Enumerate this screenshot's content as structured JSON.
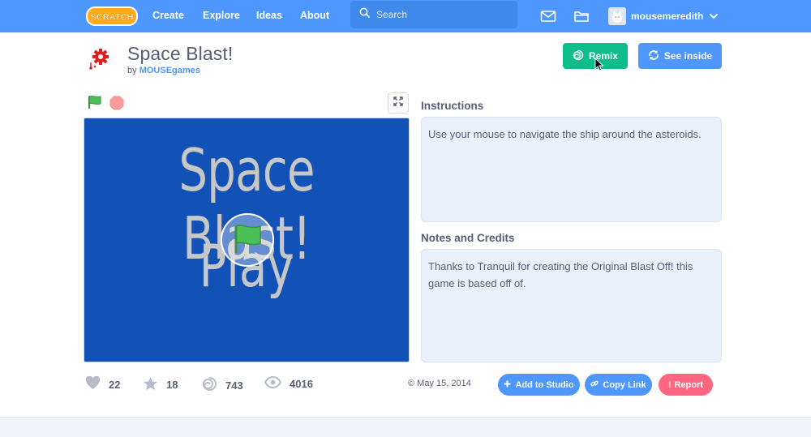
{
  "nav": {
    "logo_text": "SCRATCH",
    "links": [
      "Create",
      "Explore",
      "Ideas",
      "About"
    ],
    "search_placeholder": "Search",
    "username": "mousemeredith"
  },
  "project": {
    "title": "Space Blast!",
    "by_prefix": "by",
    "author": "MOUSEgames",
    "remix_label": "Remix",
    "see_inside_label": "See inside"
  },
  "stage": {
    "title_text": "Space Blast!",
    "play_text": "Play"
  },
  "instructions": {
    "label": "Instructions",
    "text": "Use your mouse to navigate the ship around the asteroids."
  },
  "notes": {
    "label": "Notes and Credits",
    "text": "Thanks to Tranquil for creating the Original Blast Off! this game is based off of."
  },
  "stats": {
    "loves": "22",
    "favorites": "18",
    "remixes": "743",
    "views": "4016",
    "date": "May 15, 2014"
  },
  "actions": {
    "add_to_studio": "Add to Studio",
    "copy_link": "Copy Link",
    "report": "Report"
  },
  "colors": {
    "nav_blue": "#4d97ff",
    "remix_green": "#0fbd8c",
    "report_red": "#ff6680",
    "stage_blue": "#1252b7",
    "panel_bg": "#e9f1fc"
  }
}
